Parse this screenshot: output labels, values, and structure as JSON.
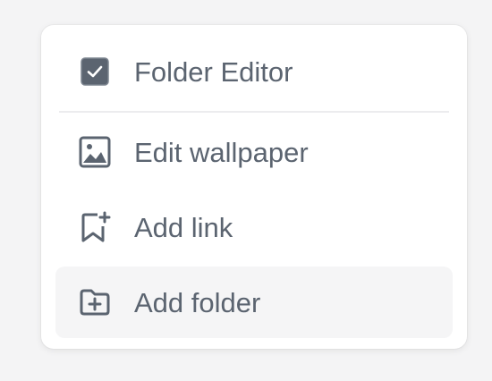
{
  "menu": {
    "items": [
      {
        "label": "Folder Editor",
        "icon": "checkbox-checked-icon",
        "checked": true
      },
      {
        "label": "Edit wallpaper",
        "icon": "image-icon"
      },
      {
        "label": "Add link",
        "icon": "bookmark-add-icon"
      },
      {
        "label": "Add folder",
        "icon": "folder-add-icon",
        "highlighted": true
      }
    ]
  },
  "colors": {
    "icon": "#5b6470",
    "text": "#5b6470",
    "checkbox_fill": "#5b6470",
    "hover_bg": "#f5f5f6",
    "background": "#f4f4f5"
  }
}
